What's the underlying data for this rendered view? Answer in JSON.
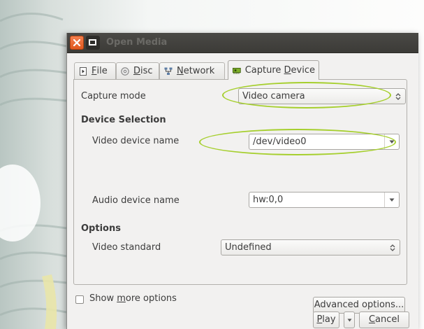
{
  "window": {
    "title": "Open Media"
  },
  "tabs": [
    {
      "label_pre": "",
      "label_mnemonic": "F",
      "label_post": "ile",
      "icon": "file-icon"
    },
    {
      "label_pre": "",
      "label_mnemonic": "D",
      "label_post": "isc",
      "icon": "disc-icon"
    },
    {
      "label_pre": "",
      "label_mnemonic": "N",
      "label_post": "etwork",
      "icon": "network-icon"
    },
    {
      "label_pre": "Capture ",
      "label_mnemonic": "D",
      "label_post": "evice",
      "icon": "capture-card-icon",
      "active": true
    }
  ],
  "capture": {
    "mode_label": "Capture mode",
    "mode_value": "Video camera",
    "device_section": "Device Selection",
    "video_device_label": "Video device name",
    "video_device_value": "/dev/video0",
    "audio_device_label": "Audio device name",
    "audio_device_value": "hw:0,0",
    "options_section": "Options",
    "video_standard_label": "Video standard",
    "video_standard_value": "Undefined",
    "advanced_button": "Advanced options..."
  },
  "footer": {
    "show_more_pre": "Show ",
    "show_more_mnemonic": "m",
    "show_more_post": "ore options",
    "play_mnemonic": "P",
    "play_post": "lay",
    "cancel_mnemonic": "C",
    "cancel_post": "ancel"
  },
  "colors": {
    "close_button": "#e95420",
    "titlebar": "#3c3b37",
    "annotation_ellipse": "#a6cf2e"
  }
}
